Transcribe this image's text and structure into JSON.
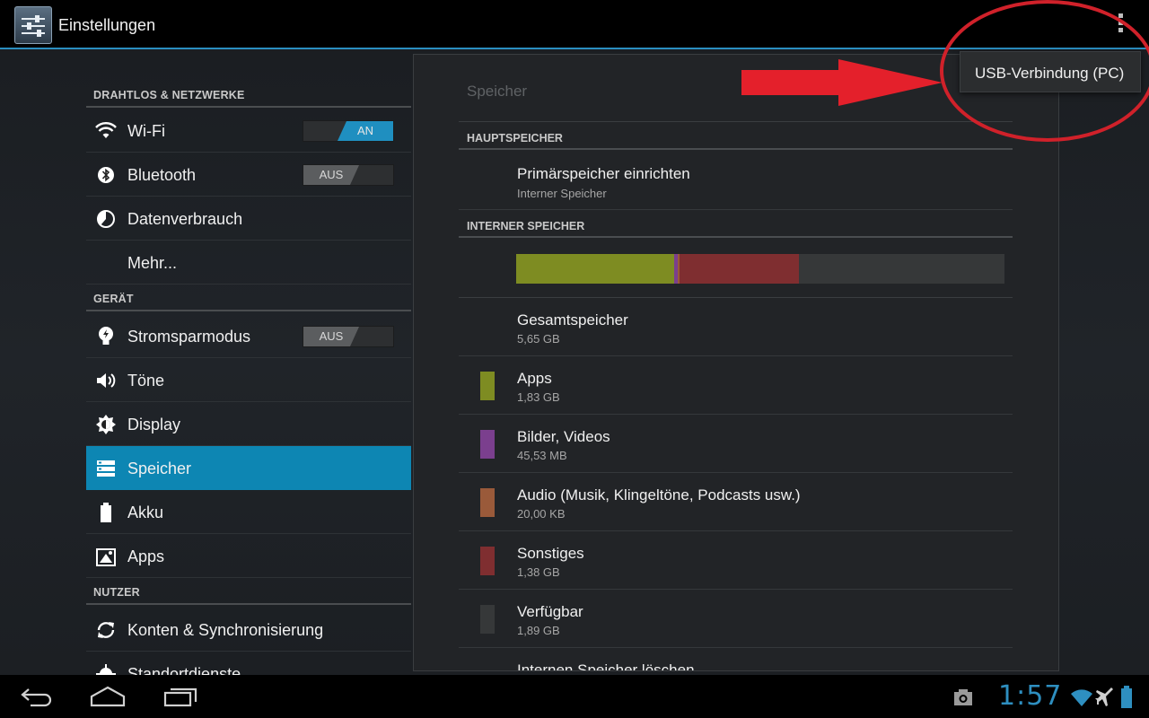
{
  "action_bar": {
    "title": "Einstellungen",
    "app_icon": "settings-sliders-icon",
    "overflow_icon": "overflow-menu-icon"
  },
  "popup_menu": {
    "items": [
      {
        "label": "USB-Verbindung (PC)"
      }
    ]
  },
  "annotation": {
    "color": "#d0212a"
  },
  "nav": {
    "sections": [
      {
        "header": "DRAHTLOS & NETZWERKE"
      },
      {
        "header": "GERÄT"
      },
      {
        "header": "NUTZER"
      }
    ],
    "items": [
      {
        "label": "Wi-Fi",
        "icon": "wifi-icon",
        "toggle": "AN"
      },
      {
        "label": "Bluetooth",
        "icon": "bluetooth-icon",
        "toggle": "AUS"
      },
      {
        "label": "Datenverbrauch",
        "icon": "data-usage-icon"
      },
      {
        "label": "Mehr..."
      },
      {
        "label": "Stromsparmodus",
        "icon": "lightbulb-icon",
        "toggle": "AUS"
      },
      {
        "label": "Töne",
        "icon": "speaker-icon"
      },
      {
        "label": "Display",
        "icon": "brightness-icon"
      },
      {
        "label": "Speicher",
        "icon": "storage-icon",
        "active": true
      },
      {
        "label": "Akku",
        "icon": "battery-icon"
      },
      {
        "label": "Apps",
        "icon": "apps-icon"
      },
      {
        "label": "Konten & Synchronisierung",
        "icon": "sync-icon"
      },
      {
        "label": "Standortdienste",
        "icon": "location-icon"
      }
    ]
  },
  "content": {
    "title": "Speicher",
    "sections": [
      {
        "header": "HAUPTSPEICHER"
      },
      {
        "header": "INTERNER SPEICHER"
      }
    ],
    "primary_row": {
      "title": "Primärspeicher einrichten",
      "subtitle": "Interner Speicher"
    },
    "usage_bar": {
      "segments": [
        {
          "name": "apps",
          "color": "#7e8c22",
          "fraction": 0.323
        },
        {
          "name": "bilder",
          "color": "#7b3f8e",
          "fraction": 0.008
        },
        {
          "name": "audio",
          "color": "#9a5a3a",
          "fraction": 0.004
        },
        {
          "name": "sonstiges",
          "color": "#7f2e30",
          "fraction": 0.244
        },
        {
          "name": "verfuegbar",
          "color": "#363839",
          "fraction": 0.421
        }
      ]
    },
    "rows": [
      {
        "title": "Gesamtspeicher",
        "value": "5,65 GB"
      },
      {
        "title": "Apps",
        "value": "1,83 GB",
        "color": "#7e8c22"
      },
      {
        "title": "Bilder, Videos",
        "value": "45,53 MB",
        "color": "#7b3f8e"
      },
      {
        "title": "Audio (Musik, Klingeltöne, Podcasts usw.)",
        "value": "20,00 KB",
        "color": "#9a5a3a"
      },
      {
        "title": "Sonstiges",
        "value": "1,38 GB",
        "color": "#7f2e30"
      },
      {
        "title": "Verfügbar",
        "value": "1,89 GB",
        "color": "#363839"
      },
      {
        "title": "Internen Speicher löschen"
      }
    ]
  },
  "system_bar": {
    "time": "1:57",
    "back_icon": "back-icon",
    "home_icon": "home-icon",
    "recents_icon": "recent-apps-icon",
    "status_icons": [
      "screenshot-icon",
      "wifi-signal-icon",
      "airplane-mode-icon",
      "battery-status-icon"
    ]
  }
}
